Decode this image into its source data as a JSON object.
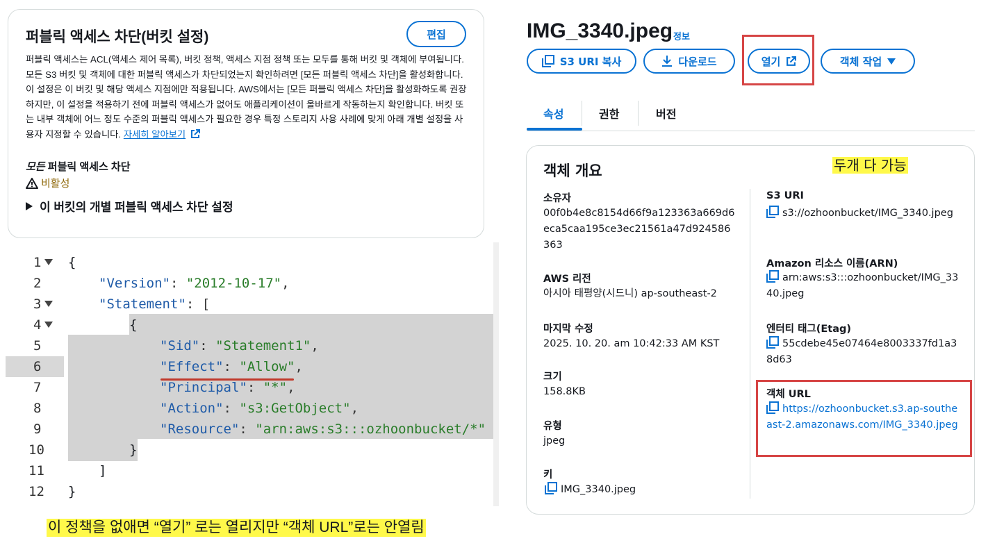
{
  "public_access": {
    "title": "퍼블릭 액세스 차단(버킷 설정)",
    "edit_label": "편집",
    "description": "퍼블릭 액세스는 ACL(액세스 제어 목록), 버킷 정책, 액세스 지점 정책 또는 모두를 통해 버킷 및 객체에 부여됩니다. 모든 S3 버킷 및 객체에 대한 퍼블릭 액세스가 차단되었는지 확인하려면 [모든 퍼블릭 액세스 차단]을 활성화합니다. 이 설정은 이 버킷 및 해당 액세스 지점에만 적용됩니다. AWS에서는 [모든 퍼블릭 액세스 차단]을 활성화하도록 권장하지만, 이 설정을 적용하기 전에 퍼블릭 액세스가 없어도 애플리케이션이 올바르게 작동하는지 확인합니다. 버킷 또는 내부 객체에 어느 정도 수준의 퍼블릭 액세스가 필요한 경우 특정 스토리지 사용 사례에 맞게 아래 개별 설정을 사용자 지정할 수 있습니다.",
    "learn_more": "자세히 알아보기",
    "all_block_em": "모든",
    "all_block_rest": " 퍼블릭 액세스 차단",
    "status": "비활성",
    "individual_settings": "이 버킷의 개별 퍼블릭 액세스 차단 설정"
  },
  "policy_editor": {
    "lines": [
      {
        "n": "1",
        "text": "{"
      },
      {
        "n": "2",
        "key": "\"Version\"",
        "val": "\"2012-10-17\"",
        "tail": ","
      },
      {
        "n": "3",
        "key": "\"Statement\"",
        "tail": ": ["
      },
      {
        "n": "4",
        "text": "{"
      },
      {
        "n": "5",
        "key": "\"Sid\"",
        "val": "\"Statement1\"",
        "tail": ","
      },
      {
        "n": "6",
        "key": "\"Effect\"",
        "val": "\"Allow\"",
        "tail": ","
      },
      {
        "n": "7",
        "key": "\"Principal\"",
        "val": "\"*\"",
        "tail": ","
      },
      {
        "n": "8",
        "key": "\"Action\"",
        "val": "\"s3:GetObject\"",
        "tail": ","
      },
      {
        "n": "9",
        "key": "\"Resource\"",
        "val": "\"arn:aws:s3:::ozhoonbucket/*\"",
        "tail": ""
      },
      {
        "n": "10",
        "text": "}"
      },
      {
        "n": "11",
        "text": "]"
      },
      {
        "n": "12",
        "text": "}"
      }
    ],
    "active_line": 6
  },
  "note_left": "이 정책을 없애면 “열기” 로는 열리지만 “객체 URL”로는 안열림",
  "object": {
    "name": "IMG_3340.jpeg",
    "info": "정보",
    "buttons": {
      "copy_uri": "S3 URI 복사",
      "download": "다운로드",
      "open": "열기",
      "actions": "객체 작업"
    },
    "tabs": [
      "속성",
      "권한",
      "버전"
    ],
    "overview_title": "객체 개요",
    "note_right": "두개 다 가능",
    "fields": {
      "owner_label": "소유자",
      "owner_value": "00f0b4e8c8154d66f9a123363a669d6eca5caa195ce3ec21561a47d924586363",
      "region_label": "AWS 리전",
      "region_value": "아시아 태평양(시드니) ap-southeast-2",
      "modified_label": "마지막 수정",
      "modified_value": "2025. 10. 20. am 10:42:33 AM KST",
      "size_label": "크기",
      "size_value": "158.8KB",
      "type_label": "유형",
      "type_value": "jpeg",
      "key_label": "키",
      "key_value": "IMG_3340.jpeg",
      "s3uri_label": "S3 URI",
      "s3uri_value": "s3://ozhoonbucket/IMG_3340.jpeg",
      "arn_label": "Amazon 리소스 이름(ARN)",
      "arn_value": "arn:aws:s3:::ozhoonbucket/IMG_3340.jpeg",
      "etag_label": "엔터티 태그(Etag)",
      "etag_value": "55cdebe45e07464e8003337fd1a38d63",
      "url_label": "객체 URL",
      "url_value": "https://ozhoonbucket.s3.ap-southeast-2.amazonaws.com/IMG_3340.jpeg"
    }
  },
  "colors": {
    "accent": "#0972d3",
    "highlight": "#fff94a",
    "annotation_red": "#d64545",
    "warning": "#8d6605"
  }
}
